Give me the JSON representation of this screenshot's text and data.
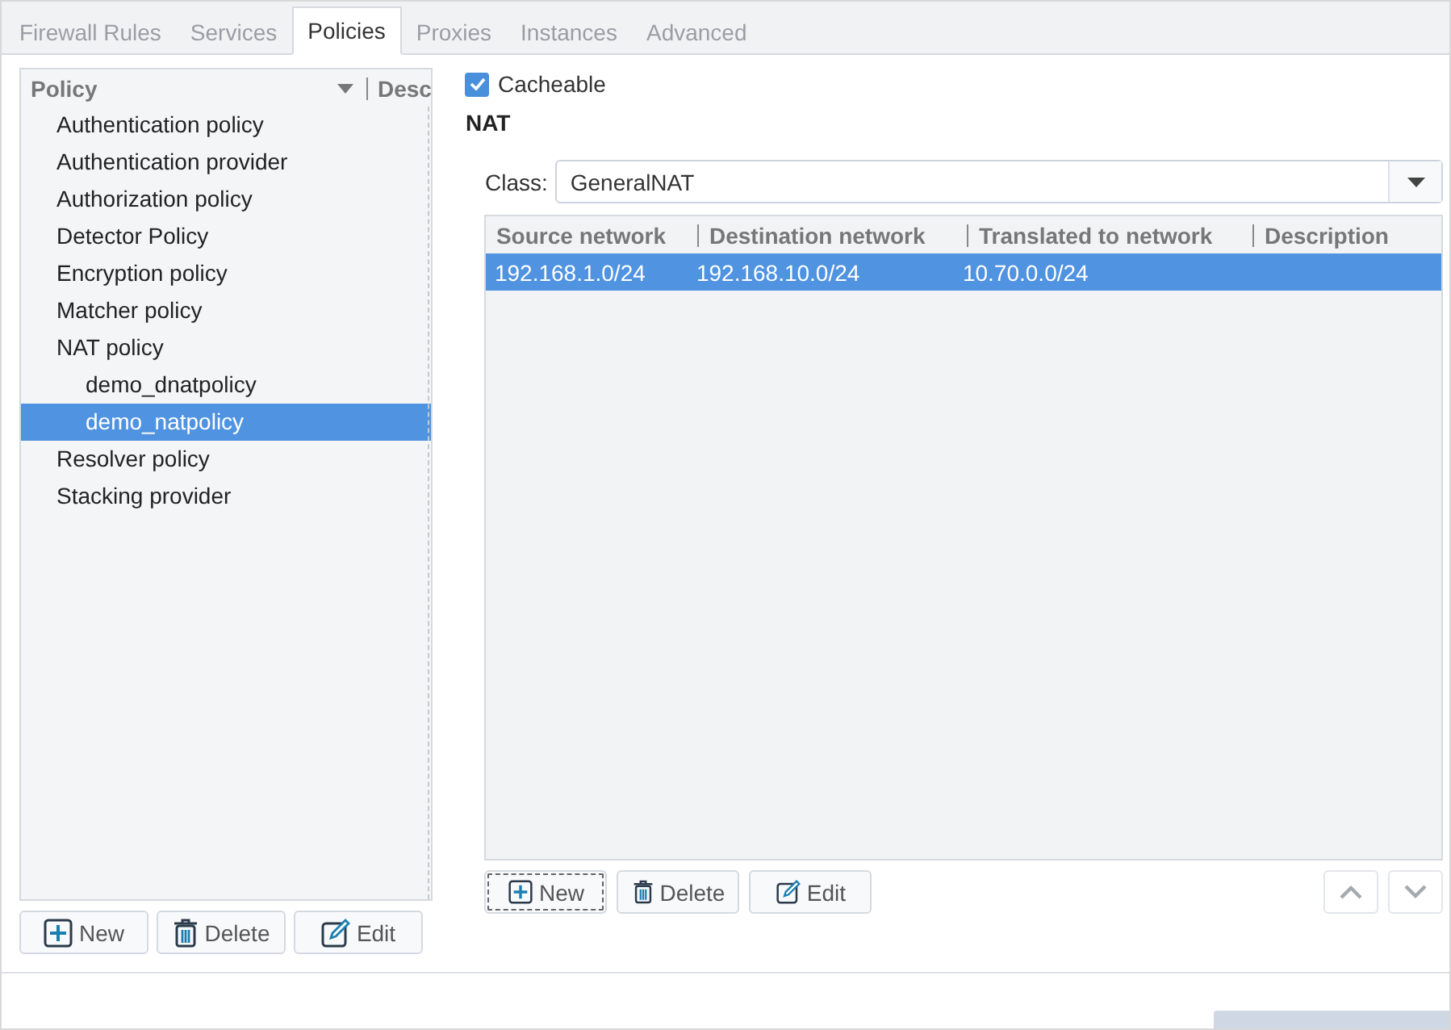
{
  "tabs": [
    {
      "label": "Firewall Rules",
      "selected": false
    },
    {
      "label": "Services",
      "selected": false
    },
    {
      "label": "Policies",
      "selected": true
    },
    {
      "label": "Proxies",
      "selected": false
    },
    {
      "label": "Instances",
      "selected": false
    },
    {
      "label": "Advanced",
      "selected": false
    }
  ],
  "policy_tree": {
    "columns": [
      "Policy",
      "Desc"
    ],
    "items": [
      {
        "label": "Authentication policy",
        "selected": false
      },
      {
        "label": "Authentication provider",
        "selected": false
      },
      {
        "label": "Authorization policy",
        "selected": false
      },
      {
        "label": "Detector Policy",
        "selected": false
      },
      {
        "label": "Encryption policy",
        "selected": false
      },
      {
        "label": "Matcher policy",
        "selected": false
      },
      {
        "label": "NAT policy",
        "selected": false,
        "children": [
          {
            "label": "demo_dnatpolicy",
            "selected": false
          },
          {
            "label": "demo_natpolicy",
            "selected": true
          }
        ]
      },
      {
        "label": "Resolver policy",
        "selected": false
      },
      {
        "label": "Stacking provider",
        "selected": false
      }
    ],
    "buttons": [
      {
        "label": "New",
        "kind": "new",
        "focused": false
      },
      {
        "label": "Delete",
        "kind": "delete",
        "focused": false
      },
      {
        "label": "Edit",
        "kind": "edit",
        "focused": false
      }
    ]
  },
  "policy_details": {
    "cacheable": {
      "label": "Cacheable",
      "checked": true
    },
    "section_title": "NAT",
    "class_field": {
      "label": "Class:",
      "value": "GeneralNAT"
    },
    "table": {
      "columns": [
        "Source network",
        "Destination network",
        "Translated to network",
        "Description"
      ],
      "rows": [
        {
          "cells": [
            "192.168.1.0/24",
            "192.168.10.0/24",
            "10.70.0.0/24",
            ""
          ],
          "selected": true
        }
      ]
    },
    "buttons": [
      {
        "label": "New",
        "kind": "new",
        "focused": true
      },
      {
        "label": "Delete",
        "kind": "delete",
        "focused": false
      },
      {
        "label": "Edit",
        "kind": "edit",
        "focused": false
      }
    ],
    "move_buttons": [
      {
        "kind": "up",
        "disabled": true
      },
      {
        "kind": "down",
        "disabled": true
      }
    ]
  }
}
